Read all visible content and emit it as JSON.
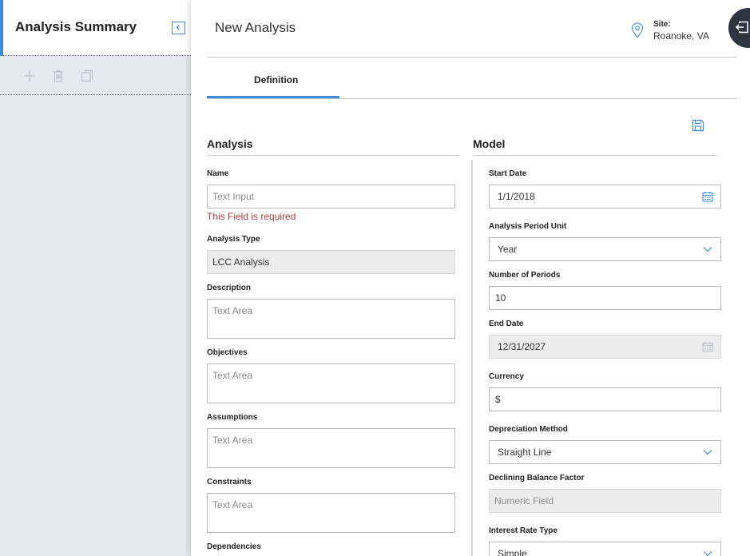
{
  "left": {
    "title": "Analysis Summary"
  },
  "header": {
    "title": "New Analysis",
    "site_label": "Site:",
    "site_value": "Roanoke, VA"
  },
  "tabs": [
    {
      "label": "Definition",
      "active": true
    }
  ],
  "analysis": {
    "title": "Analysis",
    "name_label": "Name",
    "name_placeholder": "Text Input",
    "name_error": "This Field is required",
    "type_label": "Analysis Type",
    "type_value": "LCC Analysis",
    "description_label": "Description",
    "description_placeholder": "Text Area",
    "objectives_label": "Objectives",
    "objectives_placeholder": "Text Area",
    "assumptions_label": "Assumptions",
    "assumptions_placeholder": "Text Area",
    "constraints_label": "Constraints",
    "constraints_placeholder": "Text Area",
    "dependencies_label": "Dependencies"
  },
  "model": {
    "title": "Model",
    "start_date_label": "Start Date",
    "start_date_value": "1/1/2018",
    "period_unit_label": "Analysis Period Unit",
    "period_unit_value": "Year",
    "num_periods_label": "Number of Periods",
    "num_periods_value": "10",
    "end_date_label": "End Date",
    "end_date_value": "12/31/2027",
    "currency_label": "Currency",
    "currency_value": "$",
    "depreciation_label": "Depreciation Method",
    "depreciation_value": "Straight Line",
    "declining_label": "Declining Balance Factor",
    "declining_placeholder": "Numeric Field",
    "interest_label": "Interest Rate Type",
    "interest_value": "Simple"
  },
  "colors": {
    "accent": "#3d8bd9",
    "error": "#b33a3a",
    "nav": "#2e3440"
  }
}
